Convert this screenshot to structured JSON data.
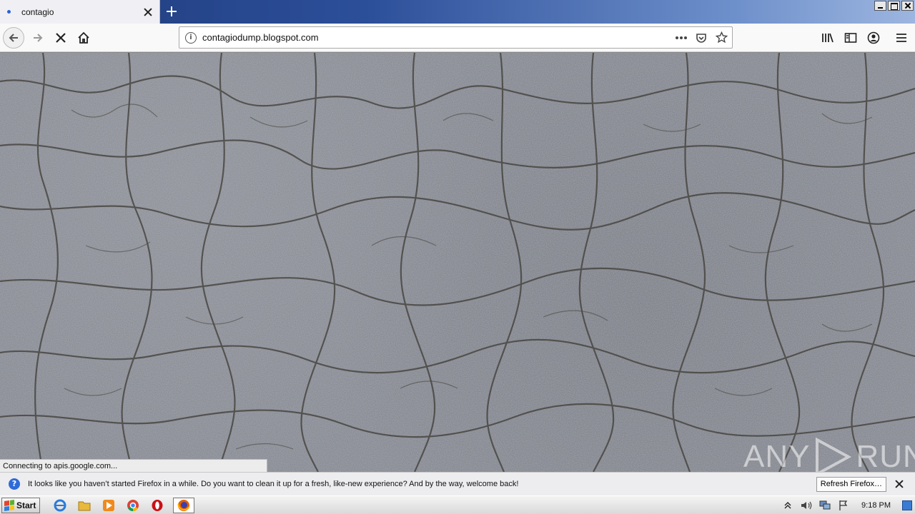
{
  "browser": {
    "tab": {
      "title": "contagio"
    },
    "url": "contagiodump.blogspot.com",
    "status_text": "Connecting to apis.google.com..."
  },
  "notification": {
    "message": "It looks like you haven’t started Firefox in a while. Do you want to clean it up for a fresh, like-new experience? And by the way, welcome back!",
    "button_label": "Refresh Firefox…"
  },
  "watermark": {
    "left": "ANY",
    "right": "RUN"
  },
  "taskbar": {
    "start_label": "Start",
    "apps": [
      "internet-explorer-icon",
      "file-explorer-icon",
      "media-player-icon",
      "chrome-icon",
      "opera-icon",
      "firefox-icon"
    ],
    "clock": "9:18 PM"
  },
  "colors": {
    "tab_strip_start": "#1f3a7a",
    "content_background": "#7d8088",
    "notification_bg": "#ededf0"
  }
}
